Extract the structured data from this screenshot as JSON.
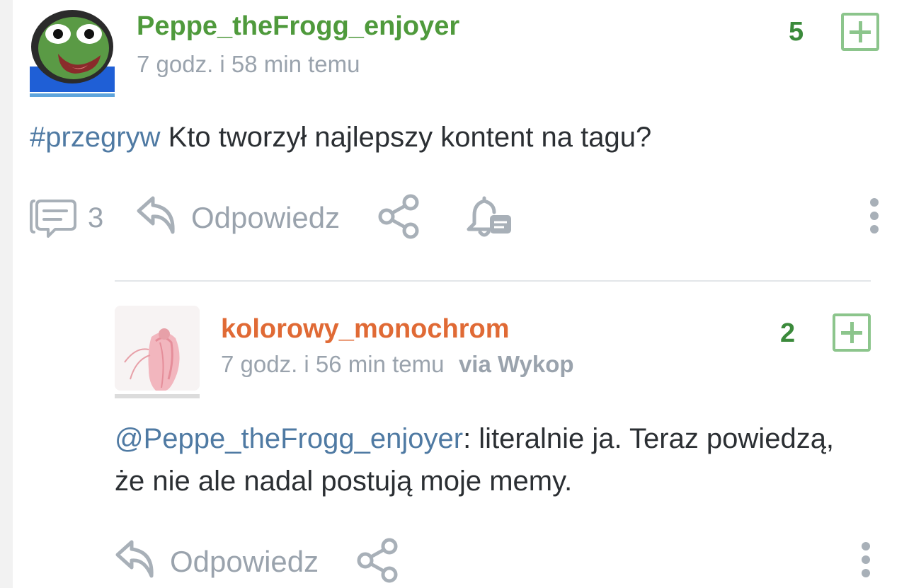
{
  "post": {
    "username": "Peppe_theFrogg_enjoyer",
    "time": "7 godz. i 58 min temu",
    "score": "5",
    "tag": "#przegryw",
    "text": " Kto tworzył najlepszy kontent na tagu?",
    "comments_count": "3",
    "reply_label": "Odpowiedz"
  },
  "reply": {
    "username": "kolorowy_monochrom",
    "time": "7 godz. i 56 min temu",
    "via": "via Wykop",
    "score": "2",
    "mention": "@Peppe_theFrogg_enjoyer",
    "text": ": literalnie ja. Teraz powiedzą, że nie ale nadal postują moje memy.",
    "reply_label": "Odpowiedz"
  },
  "colors": {
    "op_username": "#4f9a3c",
    "reply_username": "#e06a35",
    "link": "#4f7aa3",
    "score": "#3b8a3b",
    "muted": "#9aa3ad"
  },
  "icons": [
    "pepe-avatar",
    "anime-girl-avatar",
    "plus-icon",
    "comments-icon",
    "reply-arrow-icon",
    "share-icon",
    "notification-bell-icon",
    "more-dots-icon"
  ]
}
